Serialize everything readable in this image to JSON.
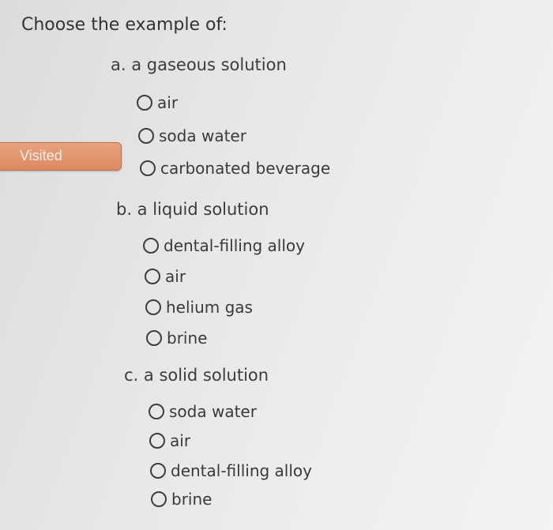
{
  "prompt": "Choose the example of:",
  "visited_label": "Visited",
  "questions": [
    {
      "label": "a. a gaseous solution",
      "options": [
        "air",
        "soda water",
        "carbonated beverage"
      ]
    },
    {
      "label": "b. a liquid solution",
      "options": [
        "dental-filling alloy",
        "air",
        "helium gas",
        "brine"
      ]
    },
    {
      "label": "c. a solid solution",
      "options": [
        "soda water",
        "air",
        "dental-filling alloy",
        "brine"
      ]
    }
  ]
}
